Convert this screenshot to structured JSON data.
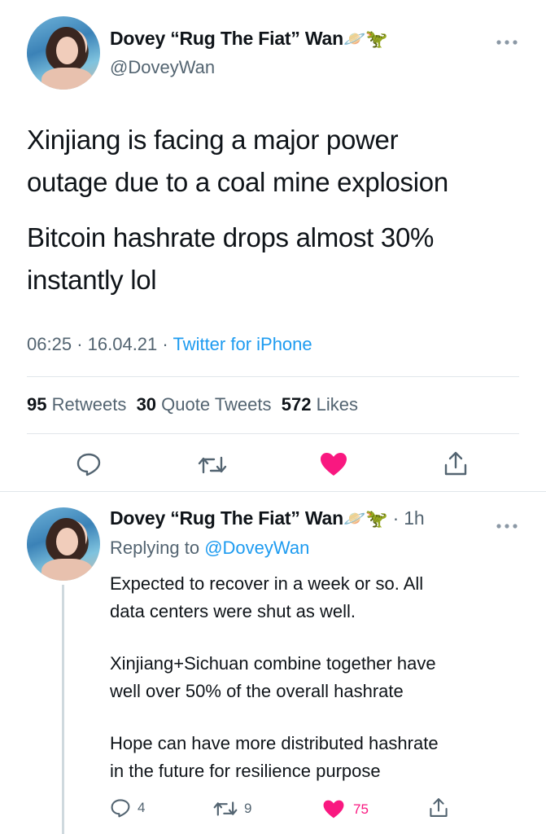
{
  "main_tweet": {
    "author_name": "Dovey “Rug The Fiat” Wan",
    "author_emojis": [
      "🪐",
      "🦖"
    ],
    "handle": "@DoveyWan",
    "paragraph1_line1": "Xinjiang is facing a major power",
    "paragraph1_line2": "outage due to a coal mine explosion",
    "paragraph2_line1": "Bitcoin hashrate drops almost 30%",
    "paragraph2_line2": "instantly lol",
    "time": "06:25",
    "date": "16.04.21",
    "source": "Twitter for iPhone",
    "retweets_count": "95",
    "retweets_label": "Retweets",
    "quotes_count": "30",
    "quotes_label": "Quote Tweets",
    "likes_count": "572",
    "likes_label": "Likes"
  },
  "reply_tweet": {
    "author_name": "Dovey “Rug The Fiat” Wan",
    "age": "1h",
    "replying_prefix": "Replying to",
    "replying_handle": "@DoveyWan",
    "lines": [
      "Expected to recover in a week or so. All",
      "data centers were shut as well.",
      "Xinjiang+Sichuan combine together have",
      "well over 50% of the overall hashrate",
      "Hope can have more distributed hashrate",
      "in the future for resilience purpose"
    ],
    "reply_count": "4",
    "retweet_count": "9",
    "like_count": "75"
  },
  "icons": {
    "more": "more-dots-icon",
    "reply": "reply-icon",
    "retweet": "retweet-icon",
    "like": "heart-icon",
    "share": "share-icon"
  },
  "colors": {
    "accent": "#1d9bf0",
    "like": "#f91880",
    "muted": "#536471"
  }
}
